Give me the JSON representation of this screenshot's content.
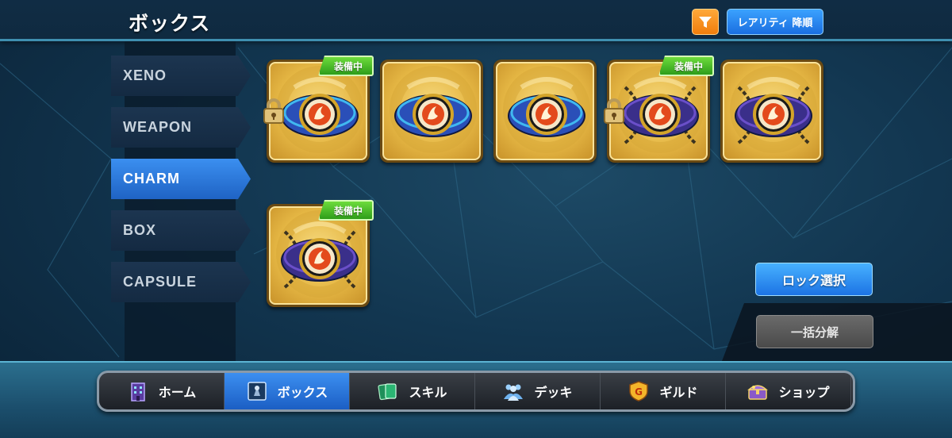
{
  "header": {
    "title": "ボックス",
    "filter_icon": "filter-funnel-icon",
    "sort_label": "レアリティ 降順"
  },
  "categories": [
    {
      "label": "XENO",
      "active": false
    },
    {
      "label": "WEAPON",
      "active": false
    },
    {
      "label": "CHARM",
      "active": true
    },
    {
      "label": "BOX",
      "active": false
    },
    {
      "label": "CAPSULE",
      "active": false
    }
  ],
  "items": [
    {
      "equipped": true,
      "locked": true,
      "style": "blue-band"
    },
    {
      "equipped": false,
      "locked": false,
      "style": "blue-band"
    },
    {
      "equipped": false,
      "locked": false,
      "style": "blue-band"
    },
    {
      "equipped": true,
      "locked": true,
      "style": "chain-band"
    },
    {
      "equipped": false,
      "locked": false,
      "style": "chain-band"
    },
    {
      "equipped": true,
      "locked": false,
      "style": "chain-band"
    }
  ],
  "equip_badge_label": "装備中",
  "actions": {
    "lock_select_label": "ロック選択",
    "bulk_dismantle_label": "一括分解"
  },
  "nav": [
    {
      "label": "ホーム",
      "icon": "building-icon",
      "active": false
    },
    {
      "label": "ボックス",
      "icon": "box-icon",
      "active": true
    },
    {
      "label": "スキル",
      "icon": "cards-icon",
      "active": false
    },
    {
      "label": "デッキ",
      "icon": "team-icon",
      "active": false
    },
    {
      "label": "ギルド",
      "icon": "guild-shield-icon",
      "active": false
    },
    {
      "label": "ショップ",
      "icon": "treasure-chest-icon",
      "active": false
    }
  ],
  "colors": {
    "accent_blue": "#2a7fe8",
    "equip_green": "#3cb521",
    "card_gold": "#e6b845",
    "filter_orange": "#f58a17"
  }
}
